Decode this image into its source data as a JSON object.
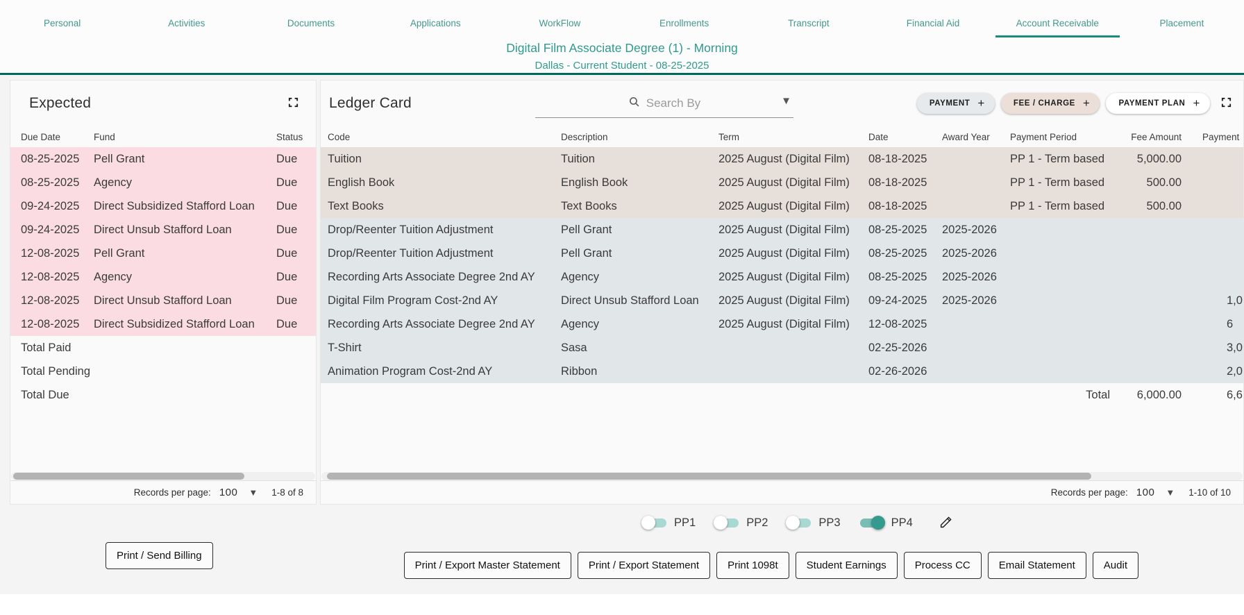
{
  "colors": {
    "accent_teal": "#2f9a8d",
    "divider_teal": "#00695f",
    "expected_row_pink": "#fbdce2",
    "charge_row_beige": "#e7dfd9",
    "credit_row_bluegray": "#e1e6e9",
    "toggle_on_teal": "#359a8e"
  },
  "nav": {
    "tabs": [
      {
        "label": "Personal"
      },
      {
        "label": "Activities"
      },
      {
        "label": "Documents"
      },
      {
        "label": "Applications"
      },
      {
        "label": "WorkFlow"
      },
      {
        "label": "Enrollments"
      },
      {
        "label": "Transcript"
      },
      {
        "label": "Financial Aid"
      },
      {
        "label": "Account Receivable"
      },
      {
        "label": "Placement"
      }
    ],
    "active_tab": "Account Receivable"
  },
  "header": {
    "title": "Digital Film Associate Degree (1) - Morning",
    "subtitle": "Dallas - Current Student - 08-25-2025"
  },
  "expected_panel": {
    "title": "Expected",
    "columns": {
      "due_date": "Due Date",
      "fund": "Fund",
      "status": "Status"
    },
    "rows": [
      {
        "due_date": "08-25-2025",
        "fund": "Pell Grant",
        "status": "Due"
      },
      {
        "due_date": "08-25-2025",
        "fund": "Agency",
        "status": "Due"
      },
      {
        "due_date": "09-24-2025",
        "fund": "Direct Subsidized Stafford Loan",
        "status": "Due"
      },
      {
        "due_date": "09-24-2025",
        "fund": "Direct Unsub Stafford Loan",
        "status": "Due"
      },
      {
        "due_date": "12-08-2025",
        "fund": "Pell Grant",
        "status": "Due"
      },
      {
        "due_date": "12-08-2025",
        "fund": "Agency",
        "status": "Due"
      },
      {
        "due_date": "12-08-2025",
        "fund": "Direct Unsub Stafford Loan",
        "status": "Due"
      },
      {
        "due_date": "12-08-2025",
        "fund": "Direct Subsidized Stafford Loan",
        "status": "Due"
      }
    ],
    "summary_rows": [
      {
        "label": "Total Paid"
      },
      {
        "label": "Total Pending"
      },
      {
        "label": "Total Due"
      }
    ],
    "pagination": {
      "label": "Records per page:",
      "per_page": "100",
      "range": "1-8 of 8"
    }
  },
  "ledger_panel": {
    "title": "Ledger Card",
    "search_placeholder": "Search By",
    "action_chips": [
      {
        "label": "PAYMENT",
        "plus": "+"
      },
      {
        "label": "FEE / CHARGE",
        "plus": "+"
      },
      {
        "label": "PAYMENT PLAN",
        "plus": "+"
      }
    ],
    "columns": {
      "code": "Code",
      "description": "Description",
      "term": "Term",
      "date": "Date",
      "award_year": "Award Year",
      "payment_period": "Payment Period",
      "fee_amount": "Fee Amount",
      "payment": "Payment"
    },
    "rows": [
      {
        "code": "Tuition",
        "description": "Tuition",
        "term": "2025 August (Digital Film)",
        "date": "08-18-2025",
        "award_year": "",
        "payment_period": "PP 1 - Term based",
        "fee_amount": "5,000.00",
        "payment": ""
      },
      {
        "code": "English Book",
        "description": "English Book",
        "term": "2025 August (Digital Film)",
        "date": "08-18-2025",
        "award_year": "",
        "payment_period": "PP 1 - Term based",
        "fee_amount": "500.00",
        "payment": ""
      },
      {
        "code": "Text Books",
        "description": "Text Books",
        "term": "2025 August (Digital Film)",
        "date": "08-18-2025",
        "award_year": "",
        "payment_period": "PP 1 - Term based",
        "fee_amount": "500.00",
        "payment": ""
      },
      {
        "code": "Drop/Reenter Tuition Adjustment",
        "description": "Pell Grant",
        "term": "2025 August (Digital Film)",
        "date": "08-25-2025",
        "award_year": "2025-2026",
        "payment_period": "",
        "fee_amount": "",
        "payment": ""
      },
      {
        "code": "Drop/Reenter Tuition Adjustment",
        "description": "Pell Grant",
        "term": "2025 August (Digital Film)",
        "date": "08-25-2025",
        "award_year": "2025-2026",
        "payment_period": "",
        "fee_amount": "",
        "payment": ""
      },
      {
        "code": "Recording Arts Associate Degree 2nd AY",
        "description": "Agency",
        "term": "2025 August (Digital Film)",
        "date": "08-25-2025",
        "award_year": "2025-2026",
        "payment_period": "",
        "fee_amount": "",
        "payment": ""
      },
      {
        "code": "Digital Film Program Cost-2nd AY",
        "description": "Direct Unsub Stafford Loan",
        "term": "2025 August (Digital Film)",
        "date": "09-24-2025",
        "award_year": "2025-2026",
        "payment_period": "",
        "fee_amount": "",
        "payment": "1,0"
      },
      {
        "code": "Recording Arts Associate Degree 2nd AY",
        "description": "Agency",
        "term": "2025 August (Digital Film)",
        "date": "12-08-2025",
        "award_year": "",
        "payment_period": "",
        "fee_amount": "",
        "payment": "6"
      },
      {
        "code": "T-Shirt",
        "description": "Sasa",
        "term": "",
        "date": "02-25-2026",
        "award_year": "",
        "payment_period": "",
        "fee_amount": "",
        "payment": "3,0"
      },
      {
        "code": "Animation Program Cost-2nd AY",
        "description": "Ribbon",
        "term": "",
        "date": "02-26-2026",
        "award_year": "",
        "payment_period": "",
        "fee_amount": "",
        "payment": "2,0"
      }
    ],
    "total_row": {
      "label": "Total",
      "fee_amount": "6,000.00",
      "payment": "6,6"
    },
    "pagination": {
      "label": "Records per page:",
      "per_page": "100",
      "range": "1-10 of 10"
    }
  },
  "toggles": [
    {
      "label": "PP1",
      "on": false
    },
    {
      "label": "PP2",
      "on": false
    },
    {
      "label": "PP3",
      "on": false
    },
    {
      "label": "PP4",
      "on": true
    }
  ],
  "footer_actions": {
    "left_button": "Print / Send Billing",
    "right_buttons": [
      {
        "label": "Print / Export Master Statement"
      },
      {
        "label": "Print / Export Statement"
      },
      {
        "label": "Print 1098t"
      },
      {
        "label": "Student Earnings"
      },
      {
        "label": "Process CC"
      },
      {
        "label": "Email Statement"
      },
      {
        "label": "Audit"
      }
    ]
  }
}
